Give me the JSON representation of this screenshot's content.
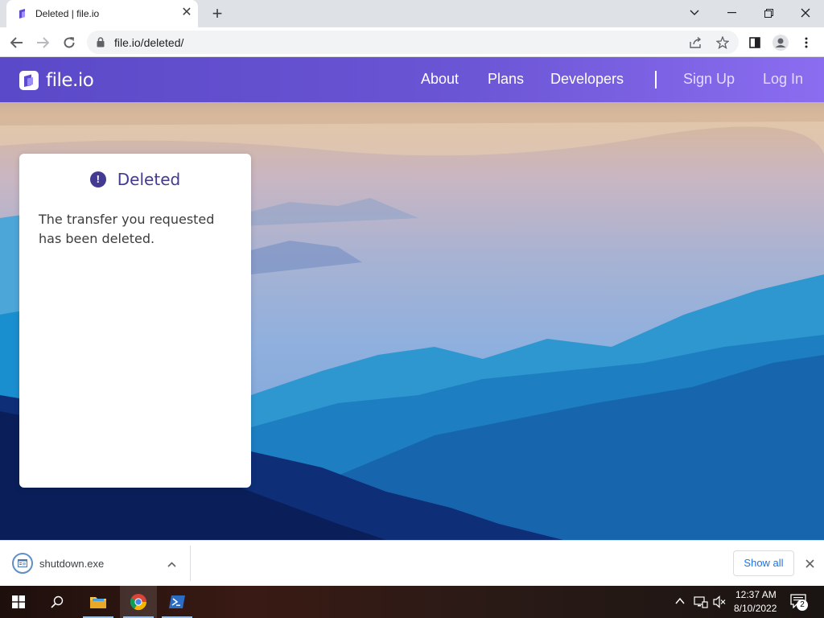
{
  "browser": {
    "tab": {
      "title": "Deleted | file.io",
      "close_label": "✕"
    },
    "new_tab_label": "+",
    "url": "file.io/deleted/"
  },
  "site": {
    "logo_text": "file.io",
    "nav": {
      "about": "About",
      "plans": "Plans",
      "developers": "Developers",
      "sign_up": "Sign Up",
      "log_in": "Log In"
    },
    "card": {
      "icon_glyph": "!",
      "title": "Deleted",
      "message": "The transfer you requested has been deleted."
    },
    "colors": {
      "nav_start": "#5a49c8",
      "nav_end": "#8b6df0",
      "accent": "#433a92"
    }
  },
  "downloads": {
    "file_name": "shutdown.exe",
    "show_all_label": "Show all"
  },
  "taskbar": {
    "time": "12:37 AM",
    "date": "8/10/2022",
    "notification_count": "2",
    "apps": [
      "start-icon",
      "search-icon",
      "file-explorer-icon",
      "chrome-icon",
      "powershell-icon"
    ]
  }
}
